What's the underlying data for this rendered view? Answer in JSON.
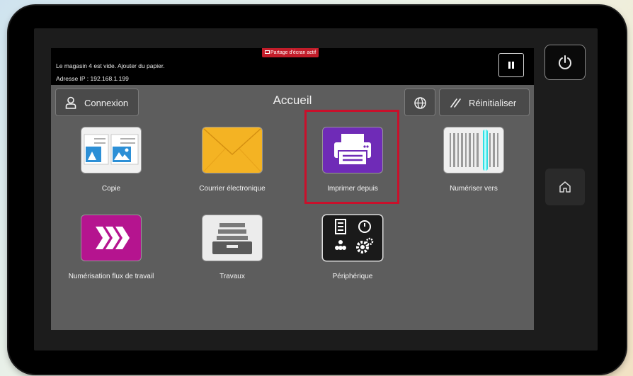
{
  "status_bar": {
    "message_line1": "Le magasin 4 est vide.  Ajouter du papier.",
    "message_line2": "Adresse IP : 192.168.1.199",
    "screen_share_badge": "Partage d’écran actif"
  },
  "header": {
    "login_label": "Connexion",
    "title": "Accueil",
    "reset_label": "Réinitialiser"
  },
  "apps": [
    {
      "label": "Copie",
      "icon": "copy-icon"
    },
    {
      "label": "Courrier électronique",
      "icon": "envelope-icon"
    },
    {
      "label": "Imprimer depuis",
      "icon": "printer-icon"
    },
    {
      "label": "Numériser vers",
      "icon": "scanner-icon"
    },
    {
      "label": "Numérisation flux de travail",
      "icon": "workflow-arrows-icon"
    },
    {
      "label": "Travaux",
      "icon": "jobs-tray-icon"
    },
    {
      "label": "Périphérique",
      "icon": "device-settings-icon"
    }
  ],
  "colors": {
    "screen_bg": "#5d5d5d",
    "highlight": "#c9102b",
    "email_yellow": "#f4b323",
    "print_purple": "#6f2bb7",
    "workflow_magenta": "#b5148f",
    "scan_cyan": "#2ee0e4"
  },
  "side_buttons": {
    "power": "power-icon",
    "home": "home-icon"
  }
}
